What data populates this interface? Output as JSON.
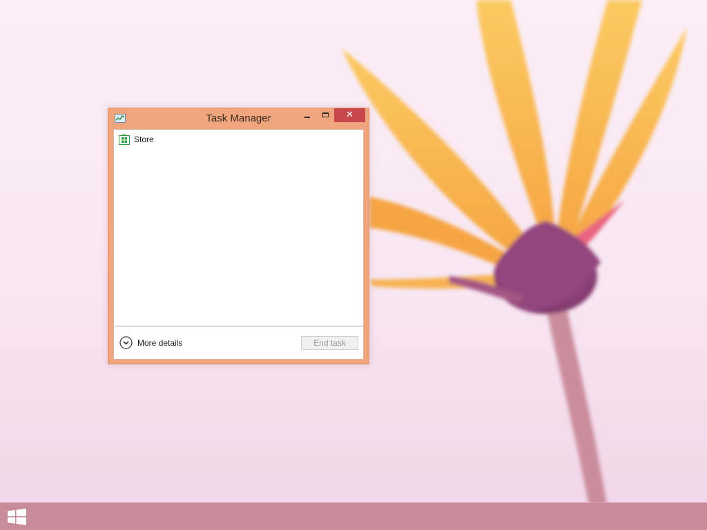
{
  "window": {
    "title": "Task Manager",
    "close_glyph": "✕",
    "app_icon": "task-manager-icon"
  },
  "processes": [
    {
      "name": "Store",
      "icon": "store-icon"
    }
  ],
  "footer": {
    "more_details_label": "More details",
    "end_task_label": "End task",
    "end_task_enabled": false
  },
  "taskbar": {
    "start_icon": "windows-logo-icon"
  },
  "colors": {
    "window_frame": "#f1a57c",
    "close_button": "#c9474b",
    "taskbar": "#c78c98",
    "desktop": "#fbeef6",
    "flower_petals": "#f7b43c",
    "flower_center": "#8e3d78"
  }
}
